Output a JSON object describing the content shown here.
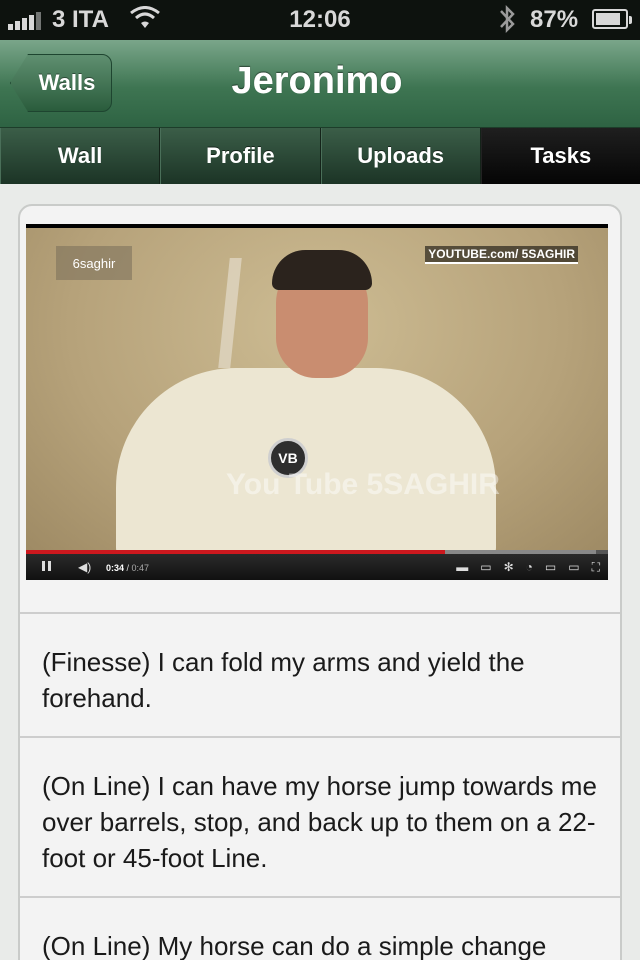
{
  "status_bar": {
    "carrier": "3 ITA",
    "time": "12:06",
    "battery": "87%",
    "battery_level": 0.87
  },
  "nav": {
    "back_label": "Walls",
    "title": "Jeronimo"
  },
  "tabs": [
    {
      "label": "Wall",
      "active": false
    },
    {
      "label": "Profile",
      "active": false
    },
    {
      "label": "Uploads",
      "active": false
    },
    {
      "label": "Tasks",
      "active": true
    }
  ],
  "video": {
    "watermark_top_left": "6saghir",
    "watermark_top_right": "YOUTUBE.com/ 5SAGHIR",
    "watermark_center": "You Tube 5SAGHIR",
    "current_time": "0:34",
    "duration": "0:47",
    "progress": 0.72,
    "buffered": 0.98
  },
  "tasks": [
    {
      "text": "(Finesse) I can fold my arms and yield the forehand."
    },
    {
      "text": "(On Line) I can have my horse jump towards me over barrels, stop, and back up to them on a 22-foot or 45-foot Line."
    },
    {
      "text": "(On Line) My horse can do a simple change"
    }
  ],
  "colors": {
    "nav_green": "#3e7552",
    "tab_active": "#0a0a0a",
    "progress_red": "#cc181e"
  }
}
